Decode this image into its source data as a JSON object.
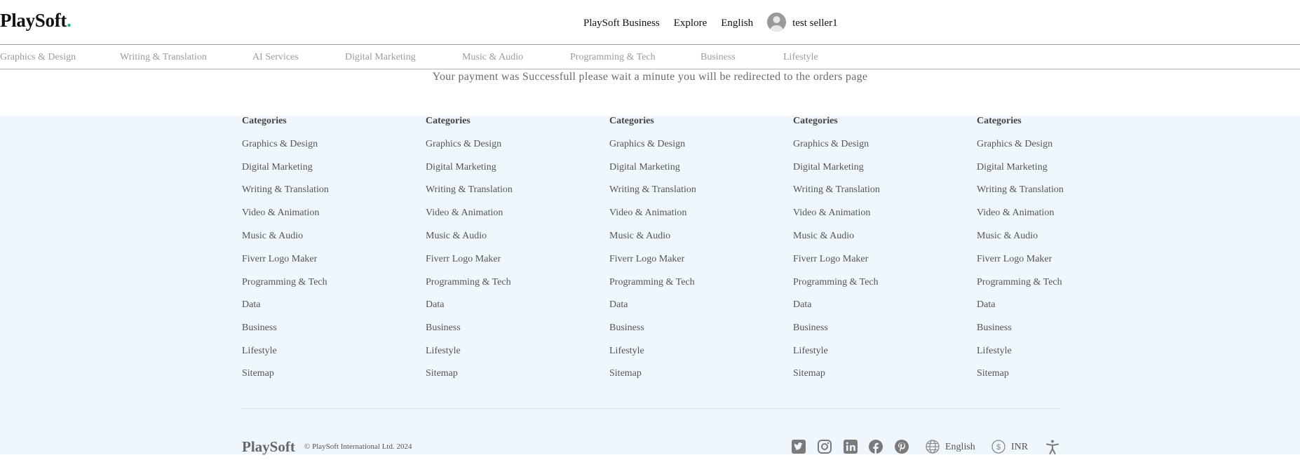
{
  "header": {
    "logo_text": "PlaySoft",
    "logo_dot": ".",
    "nav": [
      "PlaySoft Business",
      "Explore",
      "English"
    ],
    "username": "test seller1"
  },
  "categories": [
    "Graphics & Design",
    "Writing & Translation",
    "AI Services",
    "Digital Marketing",
    "Music & Audio",
    "Programming & Tech",
    "Business",
    "Lifestyle"
  ],
  "message": "Your payment was Successfull please wait a minute you will be redirected to the orders page",
  "footer": {
    "columns": [
      {
        "title": "Categories",
        "items": [
          "Graphics & Design",
          "Digital Marketing",
          "Writing & Translation",
          "Video & Animation",
          "Music & Audio",
          "Fiverr Logo Maker",
          "Programming & Tech",
          "Data",
          "Business",
          "Lifestyle",
          "Sitemap"
        ]
      },
      {
        "title": "Categories",
        "items": [
          "Graphics & Design",
          "Digital Marketing",
          "Writing & Translation",
          "Video & Animation",
          "Music & Audio",
          "Fiverr Logo Maker",
          "Programming & Tech",
          "Data",
          "Business",
          "Lifestyle",
          "Sitemap"
        ]
      },
      {
        "title": "Categories",
        "items": [
          "Graphics & Design",
          "Digital Marketing",
          "Writing & Translation",
          "Video & Animation",
          "Music & Audio",
          "Fiverr Logo Maker",
          "Programming & Tech",
          "Data",
          "Business",
          "Lifestyle",
          "Sitemap"
        ]
      },
      {
        "title": "Categories",
        "items": [
          "Graphics & Design",
          "Digital Marketing",
          "Writing & Translation",
          "Video & Animation",
          "Music & Audio",
          "Fiverr Logo Maker",
          "Programming & Tech",
          "Data",
          "Business",
          "Lifestyle",
          "Sitemap"
        ]
      },
      {
        "title": "Categories",
        "items": [
          "Graphics & Design",
          "Digital Marketing",
          "Writing & Translation",
          "Video & Animation",
          "Music & Audio",
          "Fiverr Logo Maker",
          "Programming & Tech",
          "Data",
          "Business",
          "Lifestyle",
          "Sitemap"
        ]
      }
    ],
    "brand": "PlaySoft",
    "copyright": "© PlaySoft International Ltd. 2024",
    "language": "English",
    "currency": "INR",
    "social_icons": [
      "twitter-icon",
      "instagram-icon",
      "linkedin-icon",
      "facebook-icon",
      "pinterest-icon"
    ]
  },
  "colors": {
    "accent": "#1dbf73",
    "footer_bg": "#eff7fd",
    "icon_gray": "#7a7a7a"
  }
}
